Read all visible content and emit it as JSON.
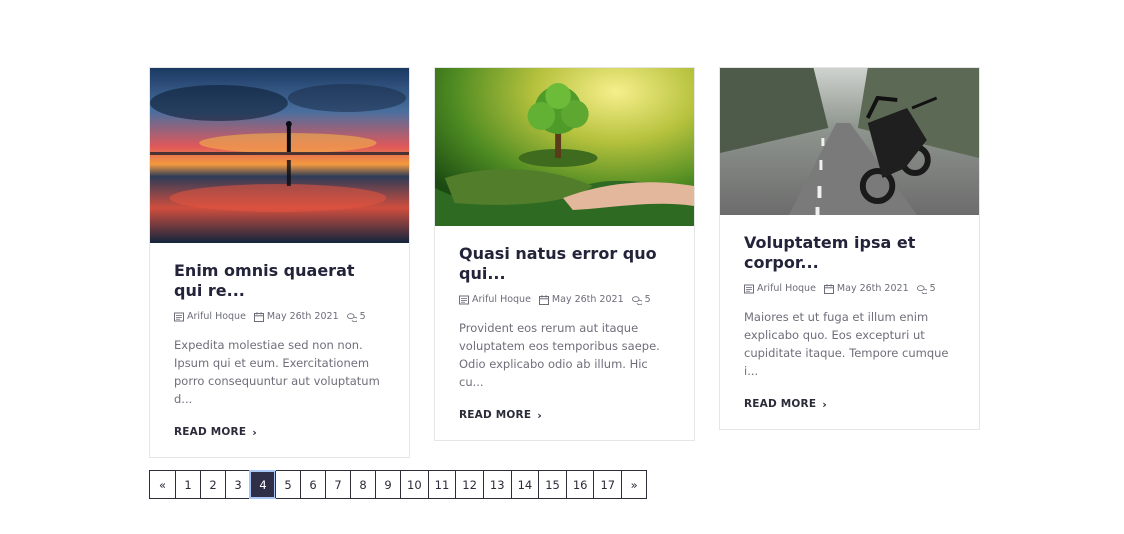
{
  "cards": [
    {
      "title": "Enim omnis quaerat qui re...",
      "author": "Ariful Hoque",
      "date": "May 26th 2021",
      "comments": "5",
      "excerpt": "Expedita molestiae sed non non. Ipsum qui et eum. Exercitationem porro consequuntur aut voluptatum d...",
      "read_more": "READ MORE",
      "image": "sunset-silhouette-photo"
    },
    {
      "title": "Quasi natus error quo qui...",
      "author": "Ariful Hoque",
      "date": "May 26th 2021",
      "comments": "5",
      "excerpt": "Provident eos rerum aut itaque voluptatem eos temporibus saepe. Odio explicabo odio ab illum. Hic cu...",
      "read_more": "READ MORE",
      "image": "tree-in-hand-photo"
    },
    {
      "title": "Voluptatem ipsa et corpor...",
      "author": "Ariful Hoque",
      "date": "May 26th 2021",
      "comments": "5",
      "excerpt": "Maiores et ut fuga et illum enim explicabo quo. Eos excepturi ut cupiditate itaque. Tempore cumque i...",
      "read_more": "READ MORE",
      "image": "motorcycle-road-photo"
    }
  ],
  "icons": {
    "author": "list-icon",
    "date": "calendar-icon",
    "comments": "comments-icon",
    "read_more": "chevron-right-icon"
  },
  "pagination": {
    "prev": "«",
    "next": "»",
    "pages": [
      "1",
      "2",
      "3",
      "4",
      "5",
      "6",
      "7",
      "8",
      "9",
      "10",
      "11",
      "12",
      "13",
      "14",
      "15",
      "16",
      "17"
    ],
    "active": "4"
  },
  "colors": {
    "accent": "#2f2f47",
    "active_outline": "#a9c6f5",
    "text": "#23233a",
    "muted": "#6f6f7b"
  }
}
